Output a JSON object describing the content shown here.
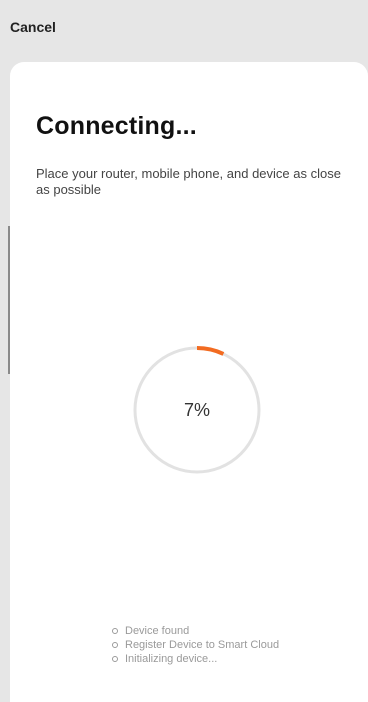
{
  "header": {
    "cancel_label": "Cancel"
  },
  "main": {
    "title": "Connecting...",
    "subtitle": "Place your router, mobile phone, and device as close as possible"
  },
  "progress": {
    "percent_label": "7%",
    "fraction": 0.07,
    "color": "#f26b21",
    "track_color": "#e2e2e2"
  },
  "steps": [
    {
      "label": "Device found"
    },
    {
      "label": "Register Device to Smart Cloud"
    },
    {
      "label": "Initializing device..."
    }
  ]
}
